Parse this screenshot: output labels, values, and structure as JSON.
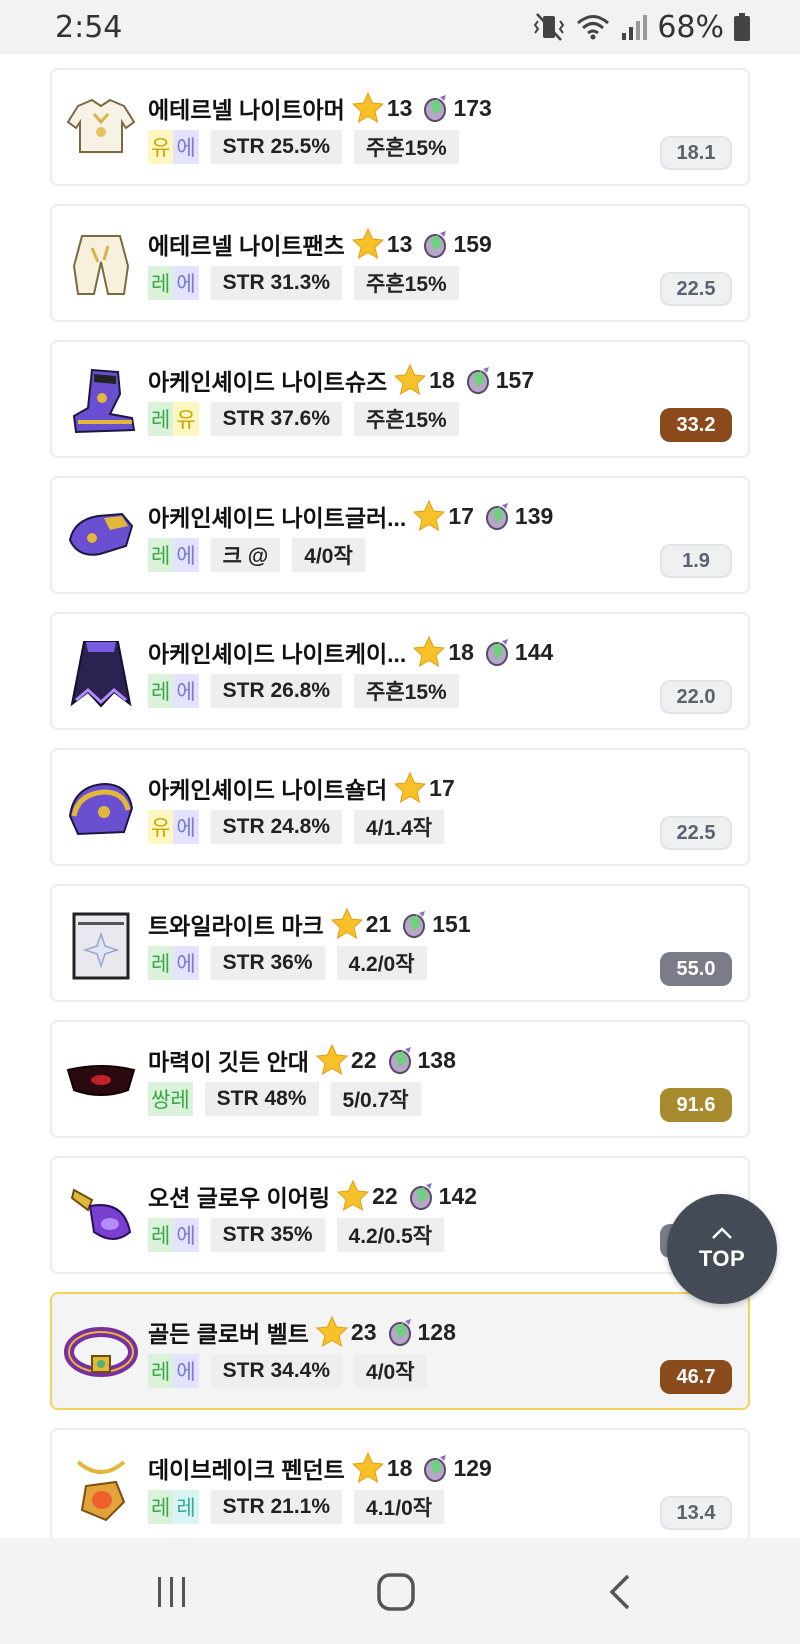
{
  "status": {
    "time": "2:54",
    "battery": "68%"
  },
  "items": [
    {
      "name": "에테르넬 나이트아머",
      "stars": "13",
      "gem": "173",
      "potential": [
        "유",
        "에"
      ],
      "potential_colors": [
        "#fff7c2",
        "#e3e3ff"
      ],
      "potential_text_colors": [
        "#c9a400",
        "#7a7ad6"
      ],
      "tag1": "STR 25.5%",
      "tag2": "주흔15%",
      "score": "18.1",
      "score_bg": "#eef0f2",
      "score_fg": "#5a6270",
      "icon": "eternel-armor-icon",
      "highlight": false
    },
    {
      "name": "에테르넬 나이트팬츠",
      "stars": "13",
      "gem": "159",
      "potential": [
        "레",
        "에"
      ],
      "potential_colors": [
        "#d9f2d9",
        "#e3e3ff"
      ],
      "potential_text_colors": [
        "#3aa84a",
        "#7a7ad6"
      ],
      "tag1": "STR 31.3%",
      "tag2": "주흔15%",
      "score": "22.5",
      "score_bg": "#eef0f2",
      "score_fg": "#5a6270",
      "icon": "eternel-pants-icon",
      "highlight": false
    },
    {
      "name": "아케인셰이드 나이트슈즈",
      "stars": "18",
      "gem": "157",
      "potential": [
        "레",
        "유"
      ],
      "potential_colors": [
        "#d9f2d9",
        "#fff7c2"
      ],
      "potential_text_colors": [
        "#3aa84a",
        "#c9a400"
      ],
      "tag1": "STR 37.6%",
      "tag2": "주흔15%",
      "score": "33.2",
      "score_bg": "#8a4a1c",
      "score_fg": "#ffffff",
      "icon": "arcane-shoes-icon",
      "highlight": false
    },
    {
      "name": "아케인셰이드 나이트글러...",
      "stars": "17",
      "gem": "139",
      "potential": [
        "레",
        "에"
      ],
      "potential_colors": [
        "#d9f2d9",
        "#e3e3ff"
      ],
      "potential_text_colors": [
        "#3aa84a",
        "#7a7ad6"
      ],
      "tag1": "크 @",
      "tag2": "4/0작",
      "score": "1.9",
      "score_bg": "#eef0f2",
      "score_fg": "#5a6270",
      "icon": "arcane-gloves-icon",
      "highlight": false
    },
    {
      "name": "아케인셰이드 나이트케이...",
      "stars": "18",
      "gem": "144",
      "potential": [
        "레",
        "에"
      ],
      "potential_colors": [
        "#d9f2d9",
        "#e3e3ff"
      ],
      "potential_text_colors": [
        "#3aa84a",
        "#7a7ad6"
      ],
      "tag1": "STR 26.8%",
      "tag2": "주흔15%",
      "score": "22.0",
      "score_bg": "#eef0f2",
      "score_fg": "#5a6270",
      "icon": "arcane-cape-icon",
      "highlight": false
    },
    {
      "name": "아케인셰이드 나이트숄더",
      "stars": "17",
      "gem": "",
      "potential": [
        "유",
        "에"
      ],
      "potential_colors": [
        "#fff7c2",
        "#e3e3ff"
      ],
      "potential_text_colors": [
        "#c9a400",
        "#7a7ad6"
      ],
      "tag1": "STR 24.8%",
      "tag2": "4/1.4작",
      "score": "22.5",
      "score_bg": "#eef0f2",
      "score_fg": "#5a6270",
      "icon": "arcane-shoulder-icon",
      "highlight": false
    },
    {
      "name": "트와일라이트 마크",
      "stars": "21",
      "gem": "151",
      "potential": [
        "레",
        "에"
      ],
      "potential_colors": [
        "#d9f2d9",
        "#e3e3ff"
      ],
      "potential_text_colors": [
        "#3aa84a",
        "#7a7ad6"
      ],
      "tag1": "STR 36%",
      "tag2": "4.2/0작",
      "score": "55.0",
      "score_bg": "#7a7c88",
      "score_fg": "#ffffff",
      "icon": "twilight-mark-icon",
      "highlight": false
    },
    {
      "name": "마력이 깃든 안대",
      "stars": "22",
      "gem": "138",
      "potential": [
        "쌍레"
      ],
      "potential_colors": [
        "#d9f2d9"
      ],
      "potential_text_colors": [
        "#3aa84a"
      ],
      "tag1": "STR 48%",
      "tag2": "5/0.7작",
      "score": "91.6",
      "score_bg": "#a88a2e",
      "score_fg": "#ffffff",
      "icon": "eyepatch-icon",
      "highlight": false
    },
    {
      "name": "오션 글로우 이어링",
      "stars": "22",
      "gem": "142",
      "potential": [
        "레",
        "에"
      ],
      "potential_colors": [
        "#d9f2d9",
        "#e3e3ff"
      ],
      "potential_text_colors": [
        "#3aa84a",
        "#7a7ad6"
      ],
      "tag1": "STR 35%",
      "tag2": "4.2/0.5작",
      "score": "52.6",
      "score_bg": "#7a7c88",
      "score_fg": "#ffffff",
      "icon": "earring-icon",
      "highlight": false
    },
    {
      "name": "골든 클로버 벨트",
      "stars": "23",
      "gem": "128",
      "potential": [
        "레",
        "에"
      ],
      "potential_colors": [
        "#d9f2d9",
        "#e3e3ff"
      ],
      "potential_text_colors": [
        "#3aa84a",
        "#7a7ad6"
      ],
      "tag1": "STR 34.4%",
      "tag2": "4/0작",
      "score": "46.7",
      "score_bg": "#8a4a1c",
      "score_fg": "#ffffff",
      "icon": "belt-icon",
      "highlight": true
    },
    {
      "name": "데이브레이크 펜던트",
      "stars": "18",
      "gem": "129",
      "potential": [
        "레",
        "레"
      ],
      "potential_colors": [
        "#d9f2d9",
        "#d9f4f4"
      ],
      "potential_text_colors": [
        "#3aa84a",
        "#3aa89a"
      ],
      "tag1": "STR 21.1%",
      "tag2": "4.1/0작",
      "score": "13.4",
      "score_bg": "#eef0f2",
      "score_fg": "#5a6270",
      "icon": "pendant-icon",
      "highlight": false
    }
  ],
  "top_button": {
    "label": "TOP"
  }
}
